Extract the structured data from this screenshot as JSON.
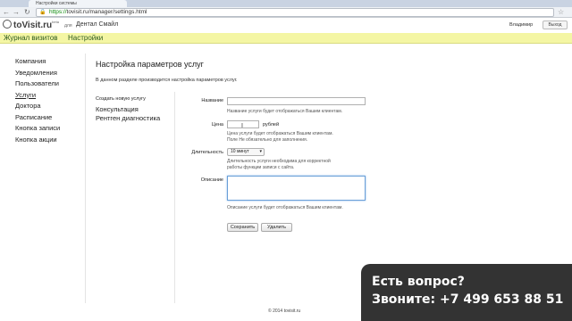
{
  "browser": {
    "tab_title": "Настройки системы",
    "url_scheme": "https://",
    "url_rest": "tovisit.ru/manager/settings.html"
  },
  "header": {
    "logo": "toVisit.ru",
    "logo_badge": "beta",
    "for_label": "для",
    "clinic_name": "Дентал Смайл",
    "user_name": "Владимир",
    "logout_label": "Выход"
  },
  "nav": {
    "items": [
      "Журнал визитов",
      "Настройки"
    ]
  },
  "sidebar": {
    "items": [
      "Компания",
      "Уведомления",
      "Пользователи",
      "Услуги",
      "Доктора",
      "Расписание",
      "Кнопка записи",
      "Кнопка акции"
    ],
    "active_index": 3
  },
  "page": {
    "title": "Настройка параметров услуг",
    "description": "В данном разделе производится настройка параметров услуг.",
    "create_link": "Создать новую услугу",
    "services": [
      "Консультация",
      "Рентген диагностика"
    ]
  },
  "form": {
    "name_label": "Название",
    "name_value": "",
    "name_hint": "Название услуги будет отображаться Вашим клиентам.",
    "price_label": "Цена",
    "price_value": "",
    "price_unit": "рублей",
    "price_hint_1": "Цена услуги будет отображаться Вашим клиентам.",
    "price_hint_2": "Поле Не обязательно для заполнения.",
    "duration_label": "Длительность",
    "duration_value": "10 минут",
    "duration_hint_1": "Длительность услуги необходима для корректной",
    "duration_hint_2": "работы функции записи с сайта.",
    "description_label": "Описание",
    "description_value": "",
    "description_hint": "Описание услуги будет отображаться Вашим клиентам.",
    "save_label": "Сохранить",
    "delete_label": "Удалить"
  },
  "footer": {
    "copyright": "© 2014 tovisit.ru"
  },
  "promo": {
    "line1": "Есть вопрос?",
    "line2": "Звоните: +7 499 653 88 51"
  }
}
